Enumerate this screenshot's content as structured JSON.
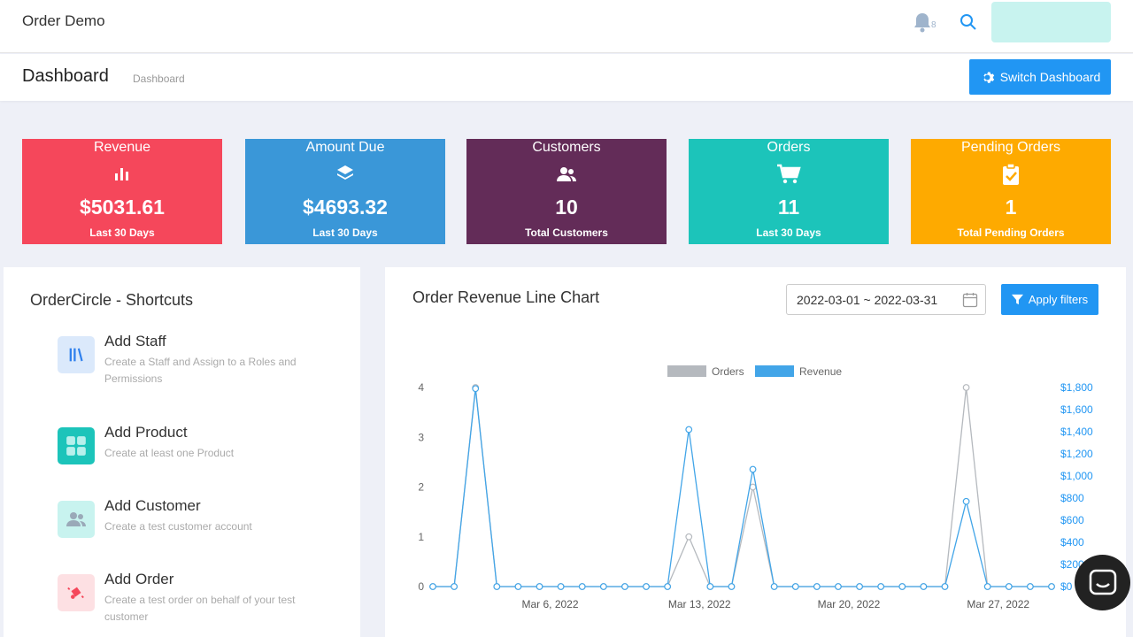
{
  "header": {
    "app_title": "Order Demo",
    "bell_badge": "8"
  },
  "subheader": {
    "title": "Dashboard",
    "breadcrumb": "Dashboard",
    "switch_label": "Switch Dashboard"
  },
  "colors": {
    "revenue": "#f5475b",
    "amount_due": "#3a97d8",
    "customers": "#632c58",
    "orders": "#1cc4ba",
    "pending": "#feaa00",
    "primary": "#2196f3"
  },
  "cards": [
    {
      "label": "Revenue",
      "value": "$5031.61",
      "sub": "Last 30 Days",
      "icon": "bar-chart-icon"
    },
    {
      "label": "Amount Due",
      "value": "$4693.32",
      "sub": "Last 30 Days",
      "icon": "layers-icon"
    },
    {
      "label": "Customers",
      "value": "10",
      "sub": "Total Customers",
      "icon": "users-icon"
    },
    {
      "label": "Orders",
      "value": "11",
      "sub": "Last 30 Days",
      "icon": "cart-icon"
    },
    {
      "label": "Pending Orders",
      "value": "1",
      "sub": "Total Pending Orders",
      "icon": "clipboard-check-icon"
    }
  ],
  "shortcuts": {
    "title": "OrderCircle - Shortcuts",
    "items": [
      {
        "name": "Add Staff",
        "desc": "Create a Staff and Assign to a Roles and Permissions",
        "icon": "books-icon"
      },
      {
        "name": "Add Product",
        "desc": "Create at least one Product",
        "icon": "grid-icon"
      },
      {
        "name": "Add Customer",
        "desc": "Create a test customer account",
        "icon": "users-icon"
      },
      {
        "name": "Add Order",
        "desc": "Create a test order on behalf of your test customer",
        "icon": "order-icon"
      }
    ]
  },
  "chart_panel": {
    "title": "Order Revenue Line Chart",
    "date_range": "2022-03-01 ~ 2022-03-31",
    "apply_label": "Apply filters"
  },
  "chart_data": {
    "type": "line",
    "legend": [
      "Orders",
      "Revenue"
    ],
    "x": [
      "2022-03-01",
      "2022-03-02",
      "2022-03-03",
      "2022-03-04",
      "2022-03-05",
      "2022-03-06",
      "2022-03-07",
      "2022-03-08",
      "2022-03-09",
      "2022-03-10",
      "2022-03-11",
      "2022-03-12",
      "2022-03-13",
      "2022-03-14",
      "2022-03-15",
      "2022-03-16",
      "2022-03-17",
      "2022-03-18",
      "2022-03-19",
      "2022-03-20",
      "2022-03-21",
      "2022-03-22",
      "2022-03-23",
      "2022-03-24",
      "2022-03-25",
      "2022-03-26",
      "2022-03-27",
      "2022-03-28",
      "2022-03-29",
      "2022-03-30"
    ],
    "x_tick_labels": [
      {
        "date": "2022-03-06",
        "label": "Mar 6, 2022"
      },
      {
        "date": "2022-03-13",
        "label": "Mar 13, 2022"
      },
      {
        "date": "2022-03-20",
        "label": "Mar 20, 2022"
      },
      {
        "date": "2022-03-27",
        "label": "Mar 27, 2022"
      }
    ],
    "series": [
      {
        "name": "Orders",
        "axis": "left",
        "color": "#b5b9be",
        "values": [
          0,
          0,
          4,
          0,
          0,
          0,
          0,
          0,
          0,
          0,
          0,
          0,
          1,
          0,
          0,
          2,
          0,
          0,
          0,
          0,
          0,
          0,
          0,
          0,
          0,
          4,
          0,
          0,
          0,
          0
        ]
      },
      {
        "name": "Revenue",
        "axis": "right",
        "color": "#42a5e8",
        "values": [
          0,
          0,
          1790,
          0,
          0,
          0,
          0,
          0,
          0,
          0,
          0,
          0,
          1420,
          0,
          0,
          1060,
          0,
          0,
          0,
          0,
          0,
          0,
          0,
          0,
          0,
          770,
          0,
          0,
          0,
          0
        ]
      }
    ],
    "y_left": {
      "ticks": [
        "0",
        "1",
        "2",
        "3",
        "4"
      ],
      "min": 0,
      "max": 4
    },
    "y_right": {
      "ticks": [
        "$0",
        "$200",
        "$400",
        "$600",
        "$800",
        "$1,000",
        "$1,200",
        "$1,400",
        "$1,600",
        "$1,800"
      ],
      "min": 0,
      "max": 1800
    },
    "legend_position": "top-center",
    "grid": false
  }
}
